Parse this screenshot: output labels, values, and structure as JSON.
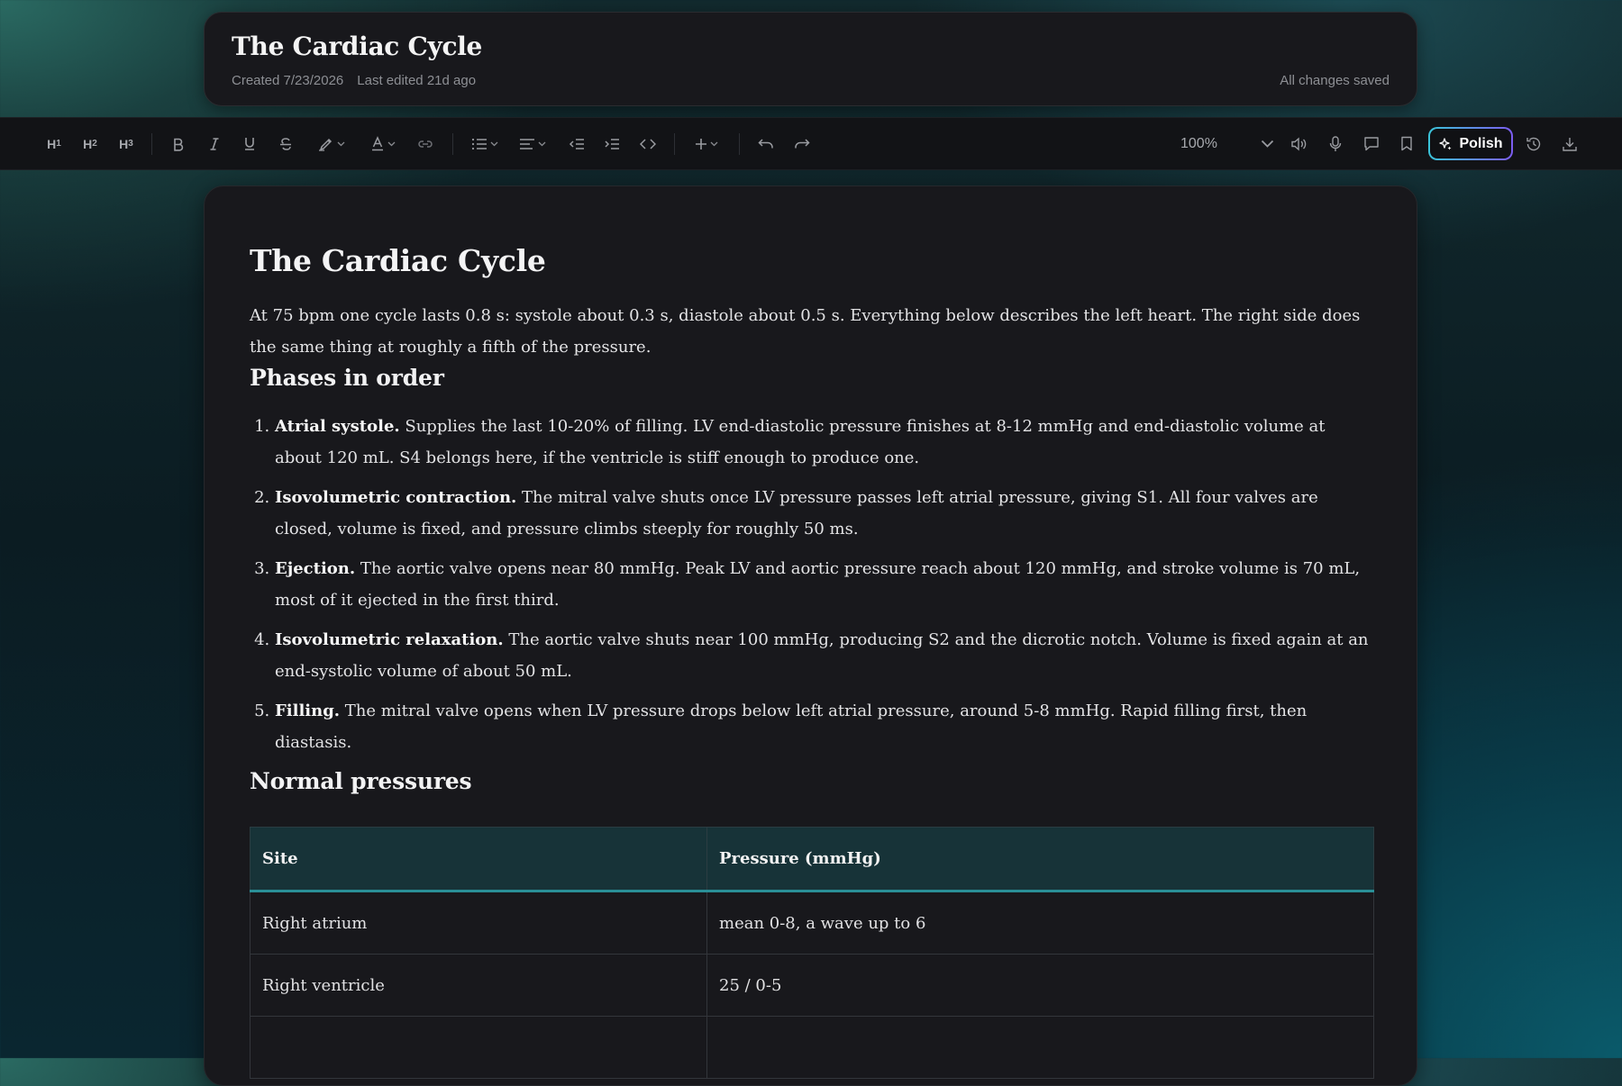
{
  "header": {
    "title": "The Cardiac Cycle",
    "created": "Created 7/23/2026",
    "last_edited": "Last edited 21d ago",
    "save_status": "All changes saved"
  },
  "toolbar": {
    "h1": "H",
    "h1_sub": "1",
    "h2": "H",
    "h2_sub": "2",
    "h3": "H",
    "h3_sub": "3",
    "zoom": "100%",
    "polish_label": "Polish",
    "icons": [
      "bold-icon",
      "italic-icon",
      "underline-icon",
      "strikethrough-icon",
      "highlighter-icon",
      "text-color-icon",
      "link-icon",
      "list-icon",
      "align-icon",
      "outdent-icon",
      "indent-icon",
      "code-icon",
      "insert-plus-icon",
      "undo-icon",
      "redo-icon",
      "speaker-icon",
      "microphone-icon",
      "comment-icon",
      "bookmark-icon",
      "sparkle-icon",
      "history-icon",
      "download-icon"
    ]
  },
  "document": {
    "title": "The Cardiac Cycle",
    "intro": "At 75 bpm one cycle lasts 0.8 s: systole about 0.3 s, diastole about 0.5 s. Everything below describes the left heart. The right side does the same thing at roughly a fifth of the pressure.",
    "phases_heading": "Phases in order",
    "phases": [
      {
        "name": "Atrial systole.",
        "text": " Supplies the last 10-20% of filling. LV end-diastolic pressure finishes at 8-12 mmHg and end-diastolic volume at about 120 mL. S4 belongs here, if the ventricle is stiff enough to produce one."
      },
      {
        "name": "Isovolumetric contraction.",
        "text": " The mitral valve shuts once LV pressure passes left atrial pressure, giving S1. All four valves are closed, volume is fixed, and pressure climbs steeply for roughly 50 ms."
      },
      {
        "name": "Ejection.",
        "text": " The aortic valve opens near 80 mmHg. Peak LV and aortic pressure reach about 120 mmHg, and stroke volume is 70 mL, most of it ejected in the first third."
      },
      {
        "name": "Isovolumetric relaxation.",
        "text": " The aortic valve shuts near 100 mmHg, producing S2 and the dicrotic notch. Volume is fixed again at an end-systolic volume of about 50 mL."
      },
      {
        "name": "Filling.",
        "text": " The mitral valve opens when LV pressure drops below left atrial pressure, around 5-8 mmHg. Rapid filling first, then diastasis."
      }
    ],
    "pressures_heading": "Normal pressures",
    "table": {
      "headers": [
        "Site",
        "Pressure (mmHg)"
      ],
      "rows": [
        [
          "Right atrium",
          "mean 0-8, a wave up to 6"
        ],
        [
          "Right ventricle",
          "25 / 0-5"
        ],
        [
          "",
          ""
        ]
      ]
    }
  },
  "colors": {
    "accent_teal": "#2a8f97",
    "polish_gradient_start": "#3ac4d8",
    "polish_gradient_end": "#7c5cf0"
  }
}
